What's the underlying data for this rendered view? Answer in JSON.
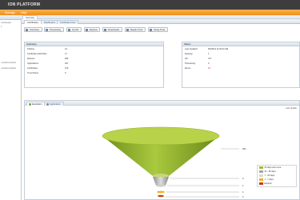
{
  "app": {
    "title": "ION PLATFORM"
  },
  "menu": [
    "Manage",
    "Help"
  ],
  "sidebar": {
    "lines": [
      "ns-ubs-gnu",
      "",
      "s",
      "",
      "",
      "~/smart-contract",
      "~/smart-contract"
    ]
  },
  "content_tabs": [
    "Summary"
  ],
  "subtabs": [
    {
      "label": "Certificates",
      "active": true
    },
    {
      "label": "Dashboard",
      "active": false
    },
    {
      "label": "Certificate Flow",
      "active": false
    }
  ],
  "toolbar": [
    "Summary",
    "Processing",
    "Up-Ok",
    "Expired",
    "Downloads",
    "Repair Trust",
    "Using Trust"
  ],
  "summary": {
    "title": "Summary",
    "rows": [
      {
        "label": "Policies",
        "value": "41"
      },
      {
        "label": "Certificate Authorities",
        "value": "17"
      },
      {
        "label": "Devices",
        "value": "366"
      },
      {
        "label": "Applications",
        "value": "327"
      },
      {
        "label": "Certificates",
        "value": "373"
      },
      {
        "label": "Trust Stores",
        "value": "0"
      }
    ]
  },
  "status": {
    "title": "Status",
    "rows": [
      {
        "label": "Last Updated:",
        "value": "5/6/2014 11:29:41 AM"
      },
      {
        "label": "Expiring:",
        "value": "1"
      },
      {
        "label": "OK:",
        "value": "377"
      },
      {
        "label": "Processing:",
        "value": "0"
      },
      {
        "label": "Errors:",
        "value": "22",
        "color": "#cc2222"
      }
    ]
  },
  "chart_tabs": [
    {
      "label": "Expiration",
      "active": true
    },
    {
      "label": "Application",
      "active": false
    }
  ],
  "last_update": "Last Update",
  "chart_data": {
    "type": "funnel",
    "categories": [
      "60 days and more",
      "31 - 60 days",
      "7 - 30 days",
      "1 - 7 days",
      "Expired"
    ],
    "values": [
      291,
      0,
      1,
      1,
      3
    ],
    "colors": [
      "#9cbe35",
      "#a6a6a6",
      "#d8d8d8",
      "#f4b020",
      "#cc3a1a"
    ]
  }
}
